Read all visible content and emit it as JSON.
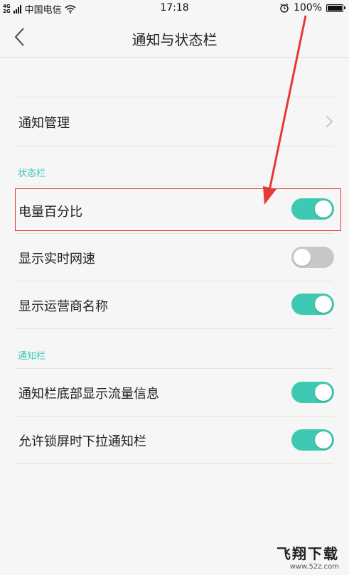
{
  "status_bar": {
    "network_top": "4G",
    "network_bottom": "2G",
    "carrier": "中国电信",
    "time": "17:18",
    "battery_text": "100%",
    "battery_level": 1.0,
    "icons": [
      "signal-icon",
      "wifi-icon",
      "alarm-icon",
      "battery-icon"
    ]
  },
  "header": {
    "title": "通知与状态栏",
    "back_icon": "chevron-left-icon"
  },
  "rows": {
    "notification_management": "通知管理",
    "section_status_bar": "状态栏",
    "battery_percentage": {
      "label": "电量百分比",
      "on": true
    },
    "realtime_speed": {
      "label": "显示实时网速",
      "on": false
    },
    "carrier_name": {
      "label": "显示运营商名称",
      "on": true
    },
    "section_notification_bar": "通知栏",
    "traffic_info": {
      "label": "通知栏底部显示流量信息",
      "on": true
    },
    "pulldown_on_lock": {
      "label": "允许锁屏时下拉通知栏",
      "on": true
    }
  },
  "watermark": {
    "brand": "飞翔下载",
    "site": "www.52z.com"
  },
  "colors": {
    "accent": "#3ec9b2",
    "toggle_off": "#c8c8c8",
    "annotation": "#e53935",
    "background": "#f6f6f6"
  }
}
